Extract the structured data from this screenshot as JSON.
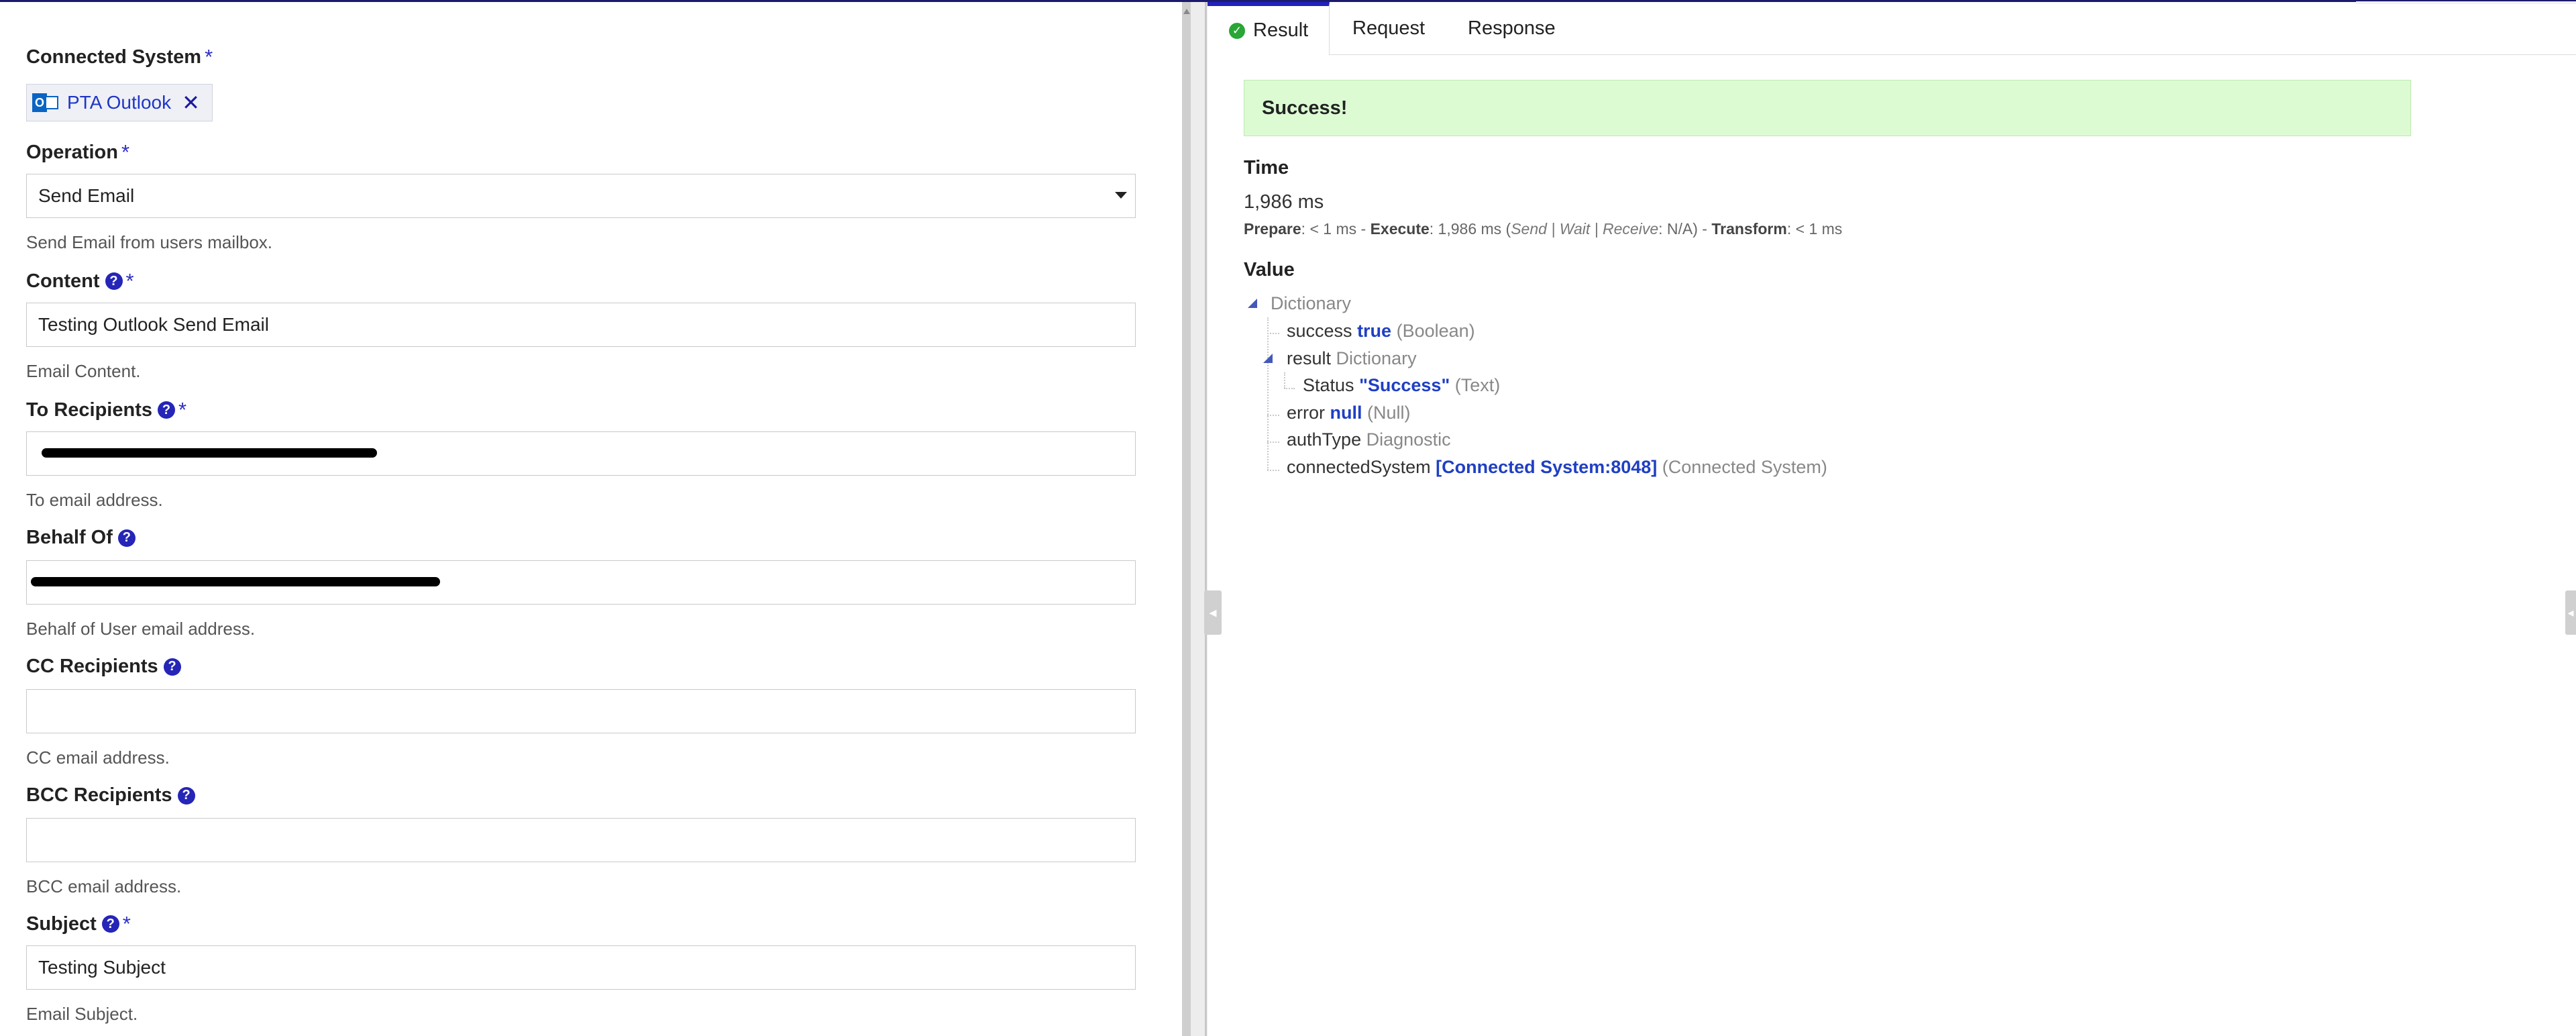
{
  "form": {
    "connected_system": {
      "label": "Connected System",
      "required": "*",
      "chip_label": "PTA Outlook",
      "chip_close": "✕",
      "icon_letter": "O"
    },
    "operation": {
      "label": "Operation",
      "required": "*",
      "value": "Send Email",
      "hint": "Send Email from users mailbox."
    },
    "content": {
      "label": "Content",
      "help": "?",
      "required": "*",
      "value": "Testing Outlook Send Email",
      "hint": "Email Content."
    },
    "to_recipients": {
      "label": "To Recipients",
      "help": "?",
      "required": "*",
      "value": "",
      "hint": "To email address."
    },
    "behalf_of": {
      "label": "Behalf Of",
      "help": "?",
      "value": "",
      "hint": "Behalf of User email address."
    },
    "cc_recipients": {
      "label": "CC Recipients",
      "help": "?",
      "value": "",
      "hint": "CC email address."
    },
    "bcc_recipients": {
      "label": "BCC Recipients",
      "help": "?",
      "value": "",
      "hint": "BCC email address."
    },
    "subject": {
      "label": "Subject",
      "help": "?",
      "required": "*",
      "value": "Testing Subject",
      "hint": "Email Subject."
    }
  },
  "tabs": {
    "result": "Result",
    "request": "Request",
    "response": "Response",
    "check": "✓"
  },
  "result": {
    "banner": "Success!",
    "time_heading": "Time",
    "time_value": "1,986 ms",
    "timing": {
      "prepare_label": "Prepare",
      "prepare_value": ": < 1 ms - ",
      "execute_label": "Execute",
      "execute_value": ": 1,986 ms (",
      "breakdown_label": "Send | Wait | Receive",
      "breakdown_value": ": N/A) - ",
      "transform_label": "Transform",
      "transform_value": ": < 1 ms"
    },
    "value_heading": "Value",
    "tree": {
      "root_type": "Dictionary",
      "success_key": "success",
      "success_value": "true",
      "success_type": "(Boolean)",
      "result_key": "result",
      "result_type": "Dictionary",
      "status_key": "Status",
      "status_value": "\"Success\"",
      "status_type": "(Text)",
      "error_key": "error",
      "error_value": "null",
      "error_type": "(Null)",
      "authtype_key": "authType",
      "authtype_value": "Diagnostic",
      "connected_key": "connectedSystem",
      "connected_value": "[Connected System:8048]",
      "connected_type": "(Connected System)"
    }
  },
  "handles": {
    "collapse_left": "◂",
    "collapse_right": "◂"
  },
  "colors": {
    "accent": "#2121bd",
    "success_bg": "#dcfbd3",
    "link": "#1f3fc4"
  }
}
